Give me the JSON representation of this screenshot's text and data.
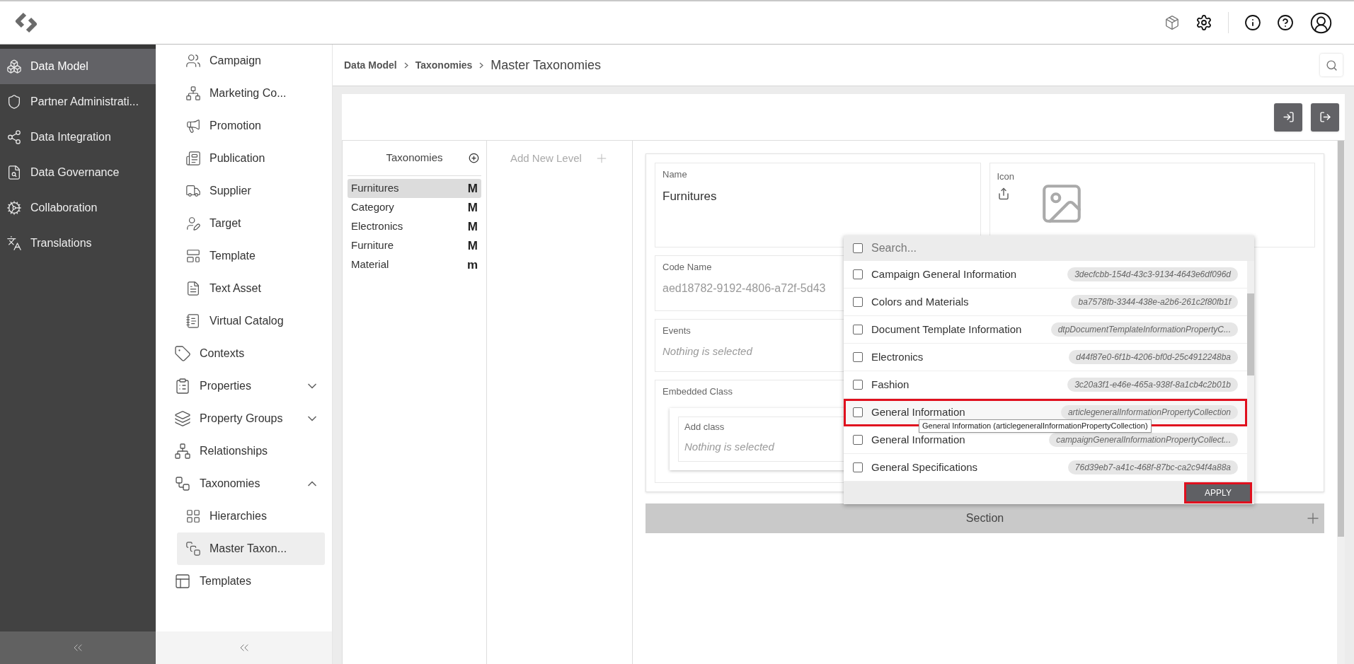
{
  "nav": {
    "items": [
      {
        "label": "Data Model",
        "selected": true
      },
      {
        "label": "Partner Administrati...",
        "selected": false
      },
      {
        "label": "Data Integration",
        "selected": false
      },
      {
        "label": "Data Governance",
        "selected": false
      },
      {
        "label": "Collaboration",
        "selected": false
      },
      {
        "label": "Translations",
        "selected": false
      }
    ]
  },
  "subnav": {
    "items": [
      {
        "kind": "section",
        "children": [
          {
            "label": "Campaign",
            "selected": false
          },
          {
            "label": "Marketing Co...",
            "selected": false
          },
          {
            "label": "Promotion",
            "selected": false
          },
          {
            "label": "Publication",
            "selected": false
          },
          {
            "label": "Supplier",
            "selected": false
          },
          {
            "label": "Target",
            "selected": false
          },
          {
            "label": "Template",
            "selected": false
          },
          {
            "label": "Text Asset",
            "selected": false
          },
          {
            "label": "Virtual Catalog",
            "selected": false
          }
        ]
      },
      {
        "kind": "link",
        "label": "Contexts",
        "selected": false
      },
      {
        "kind": "group",
        "label": "Properties",
        "expanded": false
      },
      {
        "kind": "group",
        "label": "Property Groups",
        "expanded": false
      },
      {
        "kind": "link",
        "label": "Relationships",
        "selected": false
      },
      {
        "kind": "group",
        "label": "Taxonomies",
        "expanded": true,
        "children": [
          {
            "label": "Hierarchies",
            "selected": false
          },
          {
            "label": "Master Taxon...",
            "selected": true
          }
        ]
      },
      {
        "kind": "link",
        "label": "Templates",
        "selected": false
      }
    ]
  },
  "breadcrumb": [
    {
      "label": "Data Model",
      "current": false
    },
    {
      "label": "Taxonomies",
      "current": false
    },
    {
      "label": "Master Taxonomies",
      "current": true
    }
  ],
  "taxonomies": {
    "title": "Taxonomies",
    "items": [
      {
        "label": "Furnitures",
        "badge": "M",
        "selected": true
      },
      {
        "label": "Category",
        "badge": "M",
        "selected": false
      },
      {
        "label": "Electronics",
        "badge": "M",
        "selected": false
      },
      {
        "label": "Furniture",
        "badge": "M",
        "selected": false
      },
      {
        "label": "Material",
        "badge": "m",
        "selected": false
      }
    ]
  },
  "levels": {
    "label": "Add New Level"
  },
  "form": {
    "name": {
      "label": "Name",
      "value": "Furnitures"
    },
    "icon": {
      "label": "Icon"
    },
    "code_name": {
      "label": "Code Name",
      "value": "aed18782-9192-4806-a72f-5d43"
    },
    "events": {
      "label": "Events",
      "placeholder": "Nothing is selected"
    },
    "embedded_class": {
      "label": "Embedded Class",
      "add_class": {
        "label": "Add class",
        "placeholder": "Nothing is selected"
      }
    }
  },
  "dropdown": {
    "search_placeholder": "Search...",
    "select_all_checked": false,
    "options": [
      {
        "label": "Campaign General Information",
        "code": "3decfcbb-154d-43c3-9134-4643e6df096d",
        "checked": false,
        "highlighted": false
      },
      {
        "label": "Colors and Materials",
        "code": "ba7578fb-3344-438e-a2b6-261c2f80fb1f",
        "checked": false,
        "highlighted": false
      },
      {
        "label": "Document Template Information",
        "code": "dtpDocumentTemplateInformationPropertyC...",
        "checked": false,
        "highlighted": false
      },
      {
        "label": "Electronics",
        "code": "d44f87e0-6f1b-4206-bf0d-25c4912248ba",
        "checked": false,
        "highlighted": false
      },
      {
        "label": "Fashion",
        "code": "3c20a3f1-e46e-465a-938f-8a1cb4c2b01b",
        "checked": false,
        "highlighted": false
      },
      {
        "label": "General Information",
        "code": "articlegeneralInformationPropertyCollection",
        "checked": false,
        "highlighted": true
      },
      {
        "label": "General Information",
        "code": "campaignGeneralInformationPropertyCollect...",
        "checked": false,
        "highlighted": false
      },
      {
        "label": "General Specifications",
        "code": "76d39eb7-a41c-468f-87bc-ca2c94f4a88a",
        "checked": false,
        "highlighted": false
      }
    ],
    "tooltip": "General Information (articlegeneralInformationPropertyCollection)",
    "apply": "APPLY"
  },
  "section": {
    "title": "Section"
  }
}
